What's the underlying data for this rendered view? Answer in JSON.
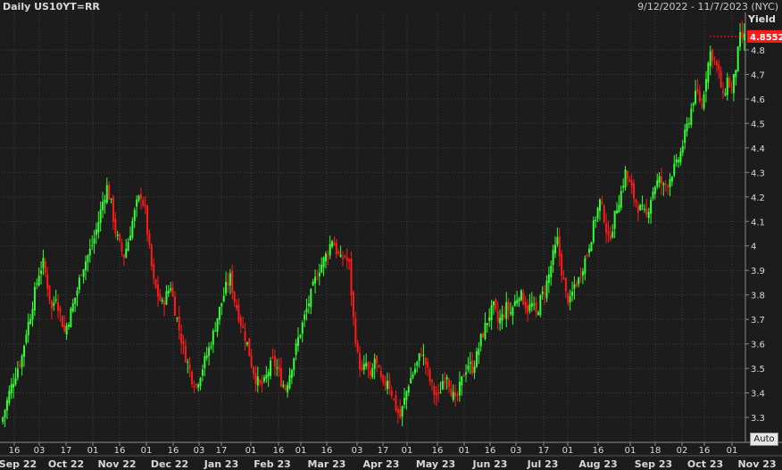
{
  "header": {
    "title": "Daily US10YT=RR",
    "date_range": "9/12/2022 - 11/7/2023 (NYC)"
  },
  "y_axis_title": "Yield",
  "auto_button_label": "Auto",
  "colors": {
    "background": "#1c1c1c",
    "grid": "#3c3c3c",
    "up": "#33ff33",
    "down": "#ff1a1a",
    "last_price_bg": "#ff1a1a"
  },
  "last_value_label": "4.8552",
  "chart_data": {
    "type": "candlestick",
    "ylim": [
      3.24,
      4.88
    ],
    "y_ticks": [
      "3.3",
      "3.4",
      "3.5",
      "3.6",
      "3.7",
      "3.8",
      "3.9",
      "4",
      "4.1",
      "4.2",
      "4.3",
      "4.4",
      "4.5",
      "4.6",
      "4.7",
      "4.8"
    ],
    "x_day_ticks": [
      "16",
      "03",
      "17",
      "01",
      "16",
      "01",
      "16",
      "03",
      "17",
      "01",
      "16",
      "01",
      "16",
      "03",
      "17",
      "01",
      "16",
      "01",
      "16",
      "03",
      "17",
      "01",
      "16",
      "01",
      "18",
      "02",
      "16",
      "01"
    ],
    "x_month_labels": [
      "Sep 22",
      "Oct 22",
      "Nov 22",
      "Dec 22",
      "Jan 23",
      "Feb 23",
      "Mar 23",
      "Apr 23",
      "May 23",
      "Jun 23",
      "Jul 23",
      "Aug 23",
      "Sep 23",
      "Oct 23",
      "Nov 23"
    ],
    "close_path": [
      [
        0,
        3.3
      ],
      [
        3,
        3.4
      ],
      [
        6,
        3.48
      ],
      [
        9,
        3.55
      ],
      [
        11,
        3.65
      ],
      [
        13,
        3.72
      ],
      [
        15,
        3.81
      ],
      [
        17,
        3.89
      ],
      [
        19,
        3.93
      ],
      [
        21,
        3.84
      ],
      [
        23,
        3.74
      ],
      [
        25,
        3.8
      ],
      [
        27,
        3.72
      ],
      [
        29,
        3.65
      ],
      [
        31,
        3.7
      ],
      [
        33,
        3.76
      ],
      [
        35,
        3.82
      ],
      [
        37,
        3.9
      ],
      [
        39,
        3.94
      ],
      [
        41,
        3.98
      ],
      [
        43,
        4.03
      ],
      [
        45,
        4.1
      ],
      [
        47,
        4.18
      ],
      [
        49,
        4.24
      ],
      [
        51,
        4.17
      ],
      [
        53,
        4.06
      ],
      [
        55,
        4.0
      ],
      [
        57,
        3.96
      ],
      [
        59,
        4.02
      ],
      [
        61,
        4.1
      ],
      [
        63,
        4.17
      ],
      [
        65,
        4.21
      ],
      [
        67,
        4.14
      ],
      [
        69,
        3.98
      ],
      [
        71,
        3.85
      ],
      [
        73,
        3.8
      ],
      [
        75,
        3.76
      ],
      [
        77,
        3.8
      ],
      [
        79,
        3.84
      ],
      [
        81,
        3.74
      ],
      [
        83,
        3.66
      ],
      [
        85,
        3.58
      ],
      [
        87,
        3.52
      ],
      [
        89,
        3.46
      ],
      [
        91,
        3.43
      ],
      [
        93,
        3.48
      ],
      [
        95,
        3.53
      ],
      [
        97,
        3.58
      ],
      [
        99,
        3.64
      ],
      [
        101,
        3.71
      ],
      [
        103,
        3.77
      ],
      [
        105,
        3.83
      ],
      [
        107,
        3.87
      ],
      [
        109,
        3.78
      ],
      [
        111,
        3.72
      ],
      [
        113,
        3.66
      ],
      [
        115,
        3.6
      ],
      [
        117,
        3.52
      ],
      [
        119,
        3.46
      ],
      [
        121,
        3.43
      ],
      [
        123,
        3.44
      ],
      [
        125,
        3.49
      ],
      [
        127,
        3.53
      ],
      [
        129,
        3.5
      ],
      [
        131,
        3.45
      ],
      [
        133,
        3.42
      ],
      [
        135,
        3.48
      ],
      [
        137,
        3.55
      ],
      [
        139,
        3.62
      ],
      [
        141,
        3.68
      ],
      [
        143,
        3.74
      ],
      [
        145,
        3.8
      ],
      [
        147,
        3.86
      ],
      [
        149,
        3.91
      ],
      [
        151,
        3.94
      ],
      [
        153,
        3.98
      ],
      [
        155,
        4.03
      ],
      [
        157,
        3.98
      ],
      [
        159,
        3.94
      ],
      [
        161,
        3.96
      ],
      [
        163,
        3.92
      ],
      [
        165,
        3.7
      ],
      [
        167,
        3.55
      ],
      [
        169,
        3.48
      ],
      [
        171,
        3.52
      ],
      [
        173,
        3.45
      ],
      [
        175,
        3.54
      ],
      [
        177,
        3.48
      ],
      [
        179,
        3.42
      ],
      [
        181,
        3.46
      ],
      [
        183,
        3.4
      ],
      [
        185,
        3.34
      ],
      [
        187,
        3.3
      ],
      [
        189,
        3.37
      ],
      [
        191,
        3.44
      ],
      [
        193,
        3.48
      ],
      [
        195,
        3.52
      ],
      [
        197,
        3.57
      ],
      [
        199,
        3.52
      ],
      [
        201,
        3.45
      ],
      [
        203,
        3.4
      ],
      [
        205,
        3.38
      ],
      [
        207,
        3.45
      ],
      [
        209,
        3.48
      ],
      [
        211,
        3.41
      ],
      [
        213,
        3.36
      ],
      [
        215,
        3.42
      ],
      [
        217,
        3.48
      ],
      [
        219,
        3.52
      ],
      [
        221,
        3.5
      ],
      [
        223,
        3.55
      ],
      [
        225,
        3.62
      ],
      [
        227,
        3.67
      ],
      [
        229,
        3.72
      ],
      [
        231,
        3.75
      ],
      [
        233,
        3.69
      ],
      [
        235,
        3.71
      ],
      [
        237,
        3.75
      ],
      [
        239,
        3.73
      ],
      [
        241,
        3.77
      ],
      [
        243,
        3.81
      ],
      [
        245,
        3.78
      ],
      [
        247,
        3.74
      ],
      [
        249,
        3.76
      ],
      [
        251,
        3.72
      ],
      [
        253,
        3.78
      ],
      [
        255,
        3.82
      ],
      [
        257,
        3.88
      ],
      [
        259,
        3.96
      ],
      [
        261,
        4.02
      ],
      [
        263,
        3.9
      ],
      [
        265,
        3.8
      ],
      [
        267,
        3.77
      ],
      [
        269,
        3.84
      ],
      [
        271,
        3.86
      ],
      [
        273,
        3.92
      ],
      [
        275,
        3.97
      ],
      [
        277,
        4.04
      ],
      [
        279,
        4.12
      ],
      [
        281,
        4.18
      ],
      [
        283,
        4.12
      ],
      [
        285,
        4.02
      ],
      [
        287,
        4.08
      ],
      [
        289,
        4.16
      ],
      [
        291,
        4.22
      ],
      [
        293,
        4.3
      ],
      [
        295,
        4.25
      ],
      [
        297,
        4.2
      ],
      [
        299,
        4.16
      ],
      [
        301,
        4.14
      ],
      [
        303,
        4.12
      ],
      [
        305,
        4.2
      ],
      [
        307,
        4.25
      ],
      [
        309,
        4.27
      ],
      [
        311,
        4.24
      ],
      [
        313,
        4.26
      ],
      [
        315,
        4.3
      ],
      [
        317,
        4.33
      ],
      [
        319,
        4.38
      ],
      [
        321,
        4.45
      ],
      [
        323,
        4.52
      ],
      [
        325,
        4.6
      ],
      [
        327,
        4.62
      ],
      [
        329,
        4.57
      ],
      [
        331,
        4.7
      ],
      [
        333,
        4.79
      ],
      [
        335,
        4.76
      ],
      [
        337,
        4.7
      ],
      [
        339,
        4.6
      ],
      [
        341,
        4.68
      ],
      [
        343,
        4.63
      ],
      [
        345,
        4.73
      ],
      [
        347,
        4.85
      ]
    ]
  }
}
